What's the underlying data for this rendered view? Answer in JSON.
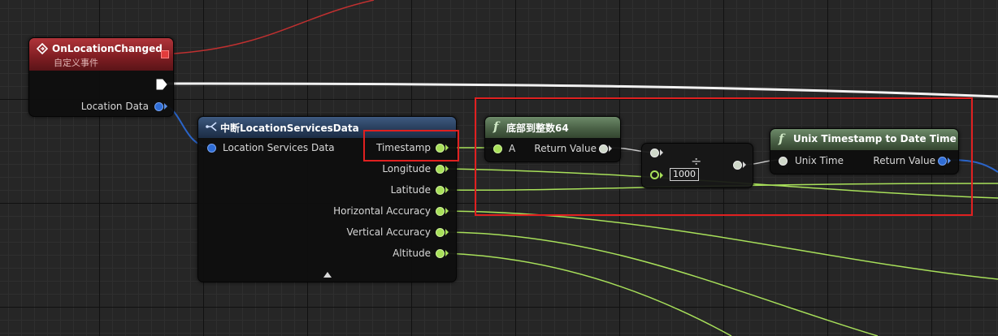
{
  "event_node": {
    "title": "OnLocationChanged",
    "subtitle": "自定义事件",
    "output_label": "Location Data"
  },
  "break_node": {
    "title": "中断LocationServicesData",
    "input_label": "Location Services Data",
    "outputs": [
      "Timestamp",
      "Longitude",
      "Latitude",
      "Horizontal Accuracy",
      "Vertical Accuracy",
      "Altitude"
    ]
  },
  "truncate_node": {
    "title": "底部到整数64",
    "input_label": "A",
    "output_label": "Return Value"
  },
  "divide_node": {
    "symbol": "÷",
    "constant_value": "1000"
  },
  "unix_node": {
    "title": "Unix Timestamp to Date Time",
    "input_label": "Unix Time",
    "output_label": "Return Value"
  },
  "colors": {
    "event_header": "#a8262b",
    "pure_header": "#526b4e",
    "float_pin": "#a8e05a",
    "struct_pin": "#2f6dd6",
    "highlight": "#e02020"
  },
  "icons": [
    "event-diamond-icon",
    "function-f-icon",
    "break-struct-icon",
    "exec-pin-icon",
    "collapse-triangle-icon"
  ]
}
